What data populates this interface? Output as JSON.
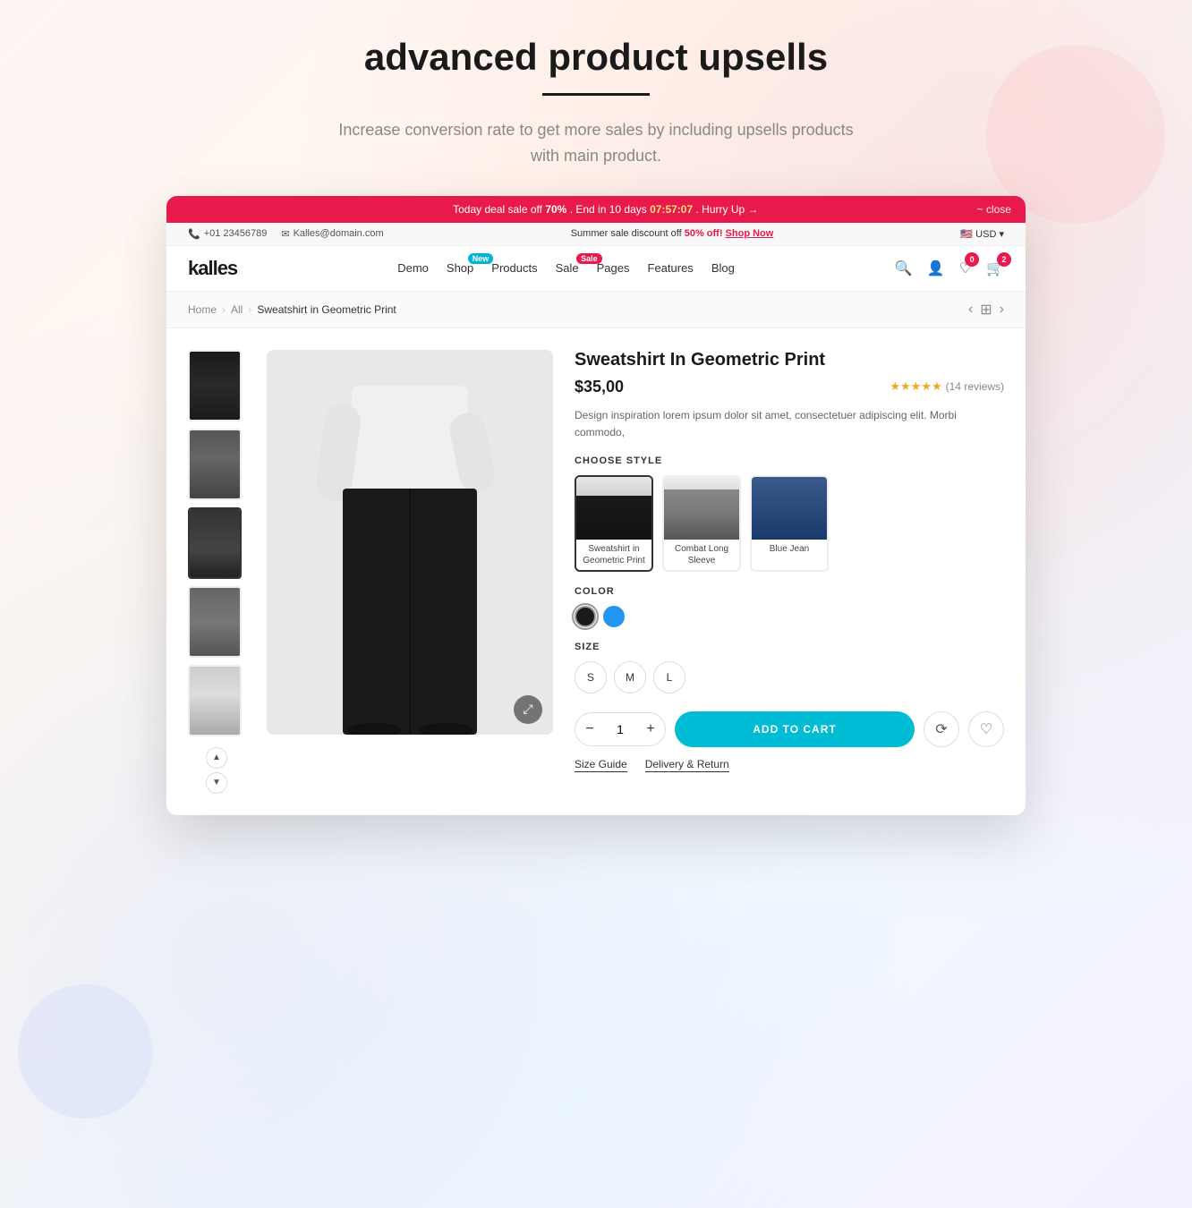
{
  "page": {
    "title": "advanced product upsells",
    "subtitle": "Increase conversion rate to get more sales by including upsells products with main product."
  },
  "promo_bar": {
    "text": "Today deal sale off",
    "discount": "70%",
    "end_label": ". End in",
    "days": "10 days",
    "timer": "07:57:07",
    "hurry": ". Hurry Up →",
    "close": "~ close"
  },
  "info_bar": {
    "phone": "+01 23456789",
    "email": "Kalles@domain.com",
    "sale_text": "Summer sale discount off",
    "sale_off": "50% off!",
    "shop_now": "Shop Now",
    "currency": "USD"
  },
  "nav": {
    "logo": "kalles",
    "links": [
      {
        "label": "Demo",
        "badge": null
      },
      {
        "label": "Shop",
        "badge": null
      },
      {
        "label": "Products",
        "badge": null
      },
      {
        "label": "Sale",
        "badge": null
      },
      {
        "label": "Pages",
        "badge": null
      },
      {
        "label": "Features",
        "badge": null
      },
      {
        "label": "Blog",
        "badge": null
      }
    ],
    "badges": {
      "shop_new": "New",
      "sale_sale": "Sale"
    },
    "wishlist_count": "0",
    "cart_count": "2"
  },
  "breadcrumb": {
    "home": "Home",
    "all": "All",
    "current": "Sweatshirt in Geometric Print"
  },
  "product": {
    "title": "Sweatshirt In Geometric Print",
    "price": "$35,00",
    "rating_stars": "★★★★★",
    "review_count": "(14 reviews)",
    "description": "Design inspiration lorem ipsum dolor sit amet, consectetuer adipiscing elit. Morbi commodo,",
    "choose_style_label": "CHOOSE STYLE",
    "styles": [
      {
        "label": "Sweatshirt in\nGeometric Print",
        "type": "style-black"
      },
      {
        "label": "Combat Long Sleeve",
        "type": "style-stripe"
      },
      {
        "label": "Blue Jean",
        "type": "style-jeans"
      }
    ],
    "color_label": "COLOR",
    "colors": [
      {
        "name": "black",
        "class": "color-black",
        "active": true
      },
      {
        "name": "blue",
        "class": "color-blue",
        "active": false
      }
    ],
    "size_label": "SIZE",
    "sizes": [
      "S",
      "M",
      "L"
    ],
    "qty": "1",
    "add_to_cart": "ADD TO CART",
    "size_guide": "Size Guide",
    "delivery_return": "Delivery & Return"
  }
}
